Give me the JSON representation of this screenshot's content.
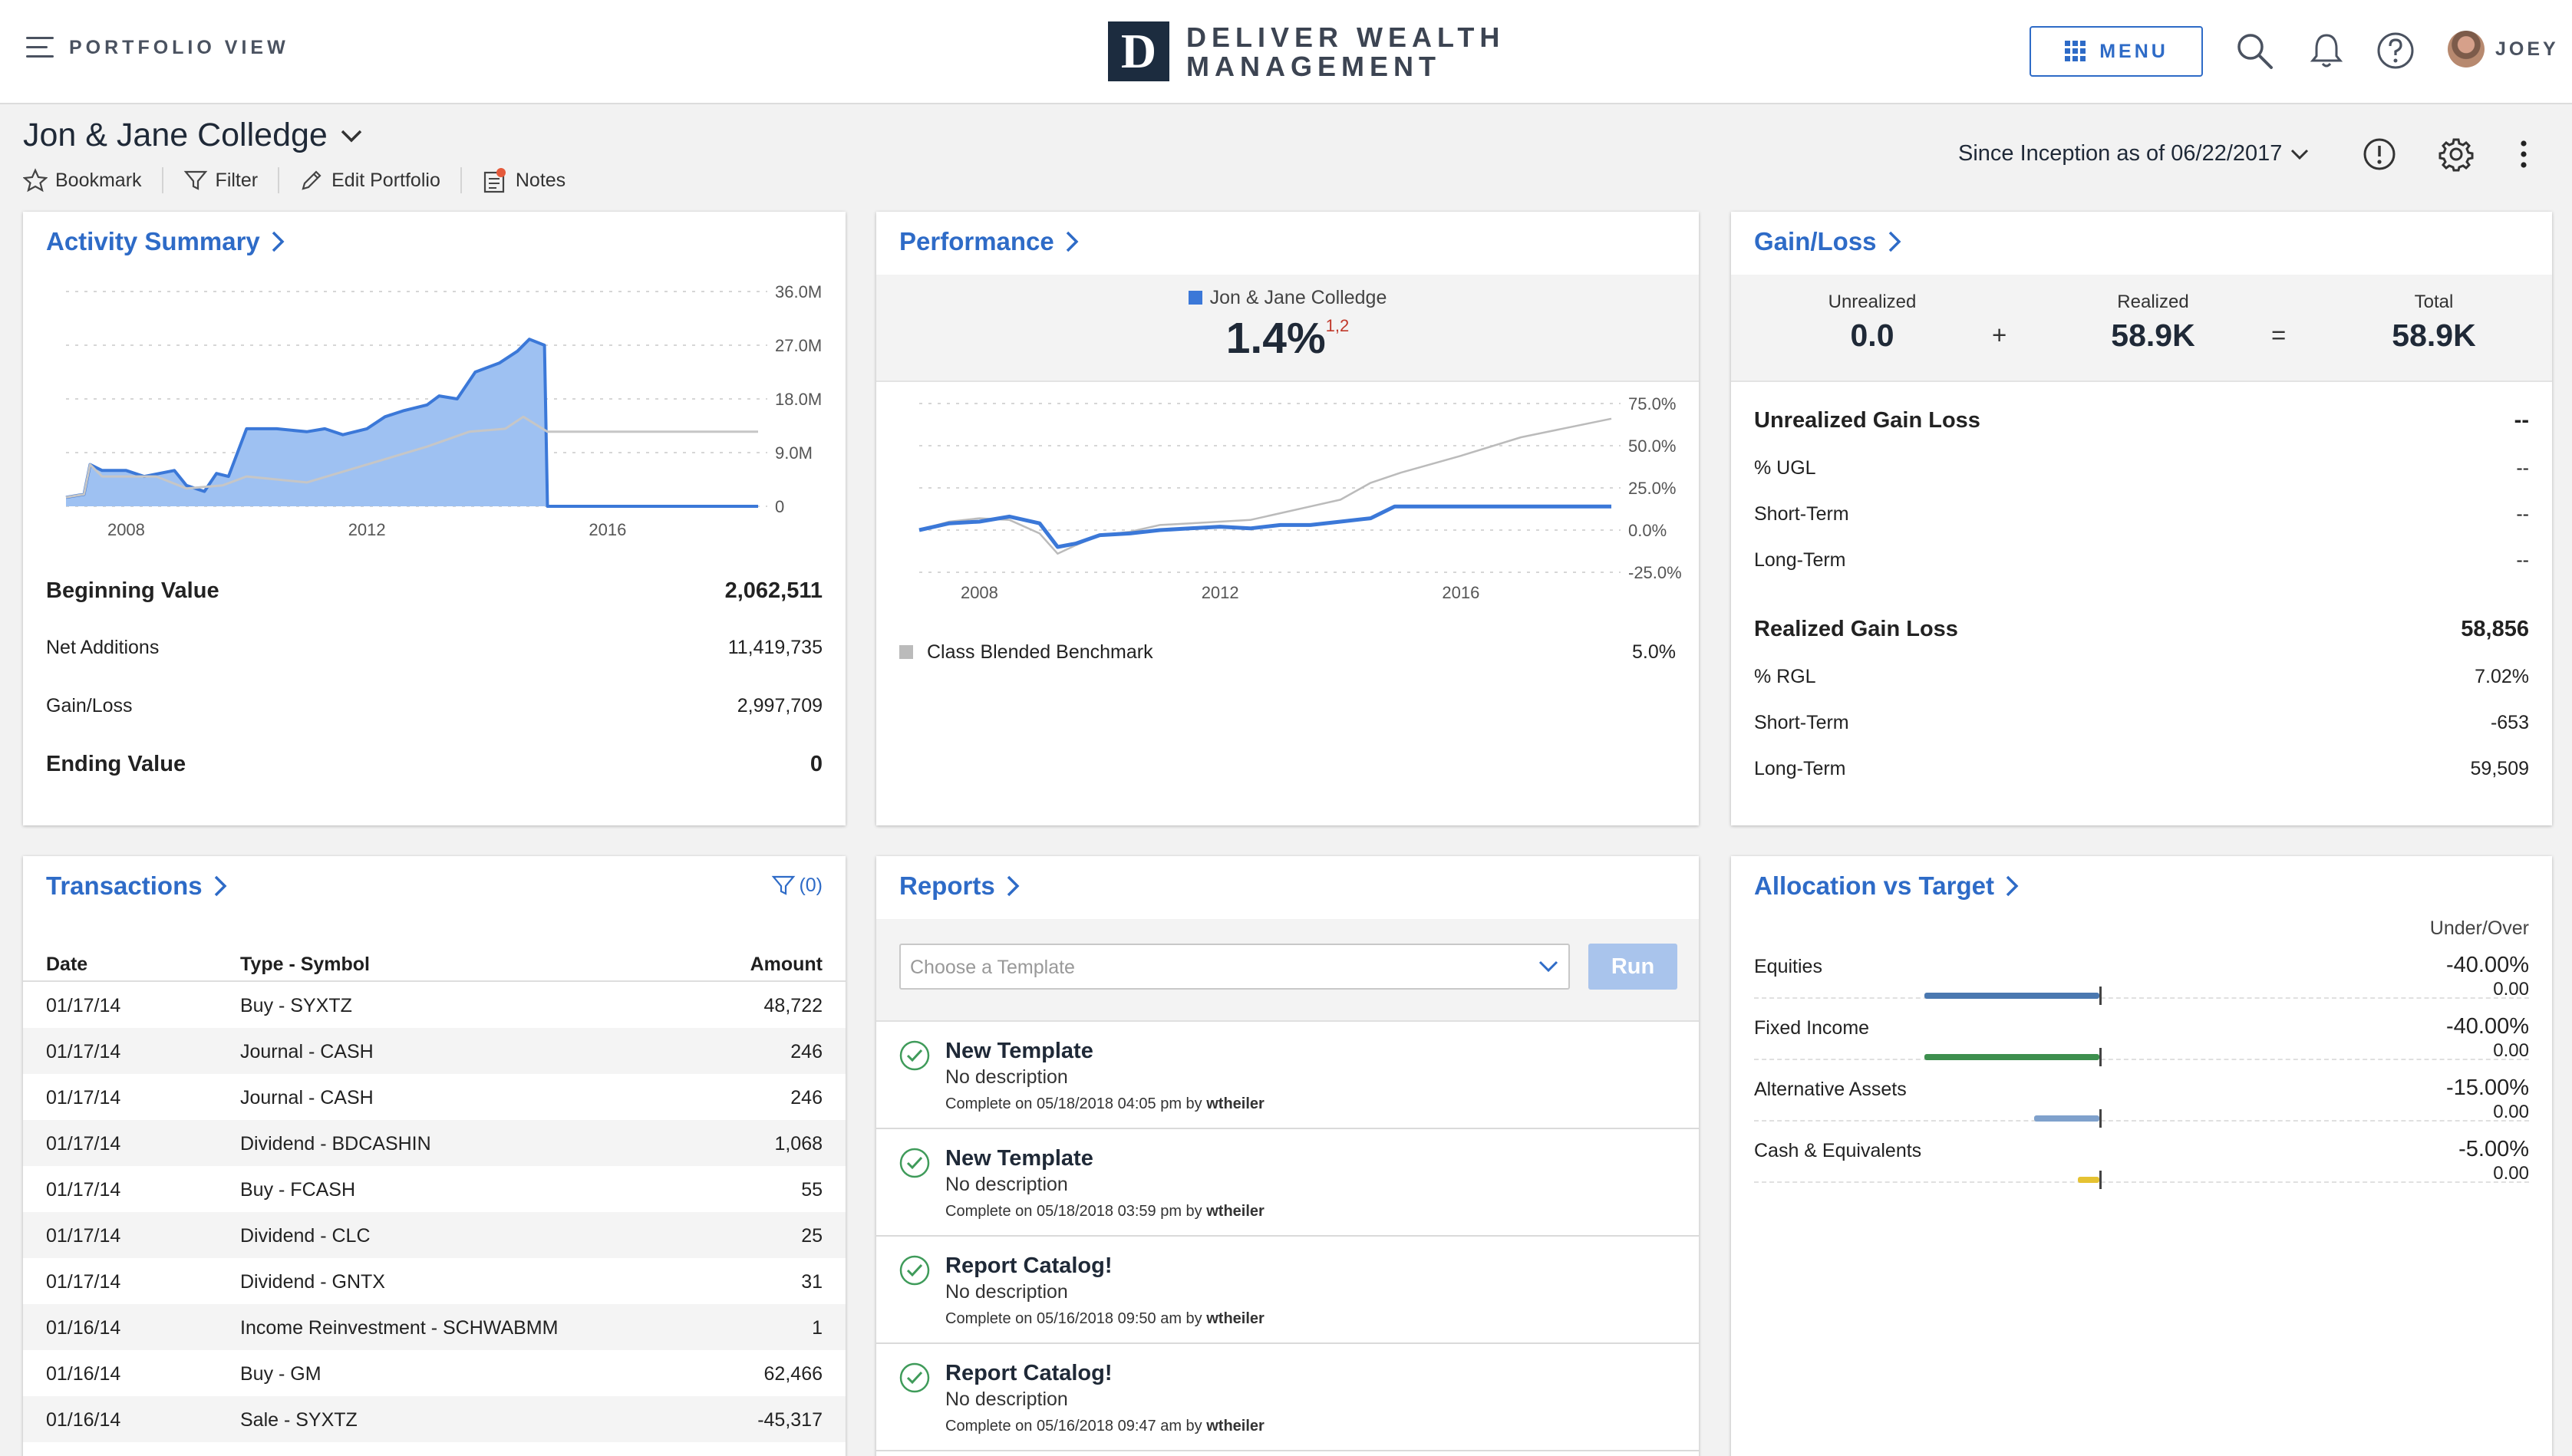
{
  "header": {
    "view_label": "PORTFOLIO VIEW",
    "logo_letter": "D",
    "logo_line1": "DELIVER WEALTH",
    "logo_line2": "MANAGEMENT",
    "menu_label": "MENU",
    "user_name": "JOEY"
  },
  "portfolio": {
    "title": "Jon & Jane Colledge",
    "actions": [
      "Bookmark",
      "Filter",
      "Edit Portfolio",
      "Notes"
    ],
    "period": "Since Inception as of 06/22/2017"
  },
  "activity": {
    "title": "Activity Summary",
    "chart_data": {
      "type": "area",
      "x_tick_labels": [
        "2008",
        "2012",
        "2016"
      ],
      "y_tick_labels": [
        "36.0M",
        "27.0M",
        "18.0M",
        "9.0M",
        "0"
      ],
      "ylim": [
        0,
        36000000
      ],
      "xlim": [
        2007.0,
        2018.5
      ],
      "series": [
        {
          "role": "value",
          "points": [
            [
              2007.0,
              1.5
            ],
            [
              2007.3,
              2.0
            ],
            [
              2007.4,
              7.0
            ],
            [
              2007.6,
              6.0
            ],
            [
              2008.0,
              6.0
            ],
            [
              2008.3,
              5.0
            ],
            [
              2008.8,
              6.0
            ],
            [
              2009.0,
              3.5
            ],
            [
              2009.3,
              2.5
            ],
            [
              2009.5,
              5.5
            ],
            [
              2009.7,
              5.0
            ],
            [
              2010.0,
              13.0
            ],
            [
              2010.5,
              13.0
            ],
            [
              2011.0,
              12.5
            ],
            [
              2011.3,
              13.0
            ],
            [
              2011.6,
              12.0
            ],
            [
              2012.0,
              13.0
            ],
            [
              2012.3,
              15.0
            ],
            [
              2012.6,
              16.0
            ],
            [
              2013.0,
              17.0
            ],
            [
              2013.2,
              18.5
            ],
            [
              2013.5,
              18.0
            ],
            [
              2013.8,
              22.5
            ],
            [
              2014.2,
              24.0
            ],
            [
              2014.5,
              26.0
            ],
            [
              2014.7,
              28.0
            ],
            [
              2014.95,
              27.0
            ],
            [
              2015.0,
              0.0
            ],
            [
              2018.5,
              0.0
            ]
          ]
        },
        {
          "role": "secondary",
          "points": [
            [
              2007.0,
              1.5
            ],
            [
              2007.3,
              2.0
            ],
            [
              2007.4,
              7.0
            ],
            [
              2007.6,
              5.0
            ],
            [
              2008.5,
              5.0
            ],
            [
              2009.0,
              3.0
            ],
            [
              2009.6,
              3.5
            ],
            [
              2010.0,
              5.0
            ],
            [
              2011.0,
              4.0
            ],
            [
              2012.0,
              7.0
            ],
            [
              2013.0,
              10.0
            ],
            [
              2013.7,
              12.5
            ],
            [
              2014.3,
              13.0
            ],
            [
              2014.6,
              15.0
            ],
            [
              2015.0,
              12.5
            ],
            [
              2018.5,
              12.5
            ]
          ]
        }
      ]
    },
    "rows": [
      {
        "label": "Beginning Value",
        "value": "2,062,511",
        "bold": true
      },
      {
        "label": "Net Additions",
        "value": "11,419,735",
        "bold": false
      },
      {
        "label": "Gain/Loss",
        "value": "2,997,709",
        "bold": false
      },
      {
        "label": "Ending Value",
        "value": "0",
        "bold": true
      }
    ]
  },
  "performance": {
    "title": "Performance",
    "legend_name": "Jon & Jane Colledge",
    "value": "1.4%",
    "footnote": "1,2",
    "chart_data": {
      "type": "line",
      "x_tick_labels": [
        "2008",
        "2012",
        "2016"
      ],
      "y_tick_labels": [
        "75.0%",
        "50.0%",
        "25.0%",
        "0.0%",
        "-25.0%"
      ],
      "ylim": [
        -25,
        75
      ],
      "xlim": [
        2007.0,
        2018.5
      ],
      "series": [
        {
          "name": "Jon & Jane Colledge",
          "color": "#3b78d8",
          "points": [
            [
              2007.0,
              0
            ],
            [
              2007.5,
              4
            ],
            [
              2008.0,
              5
            ],
            [
              2008.5,
              8
            ],
            [
              2009.0,
              4
            ],
            [
              2009.3,
              -10
            ],
            [
              2009.6,
              -8
            ],
            [
              2010.0,
              -3
            ],
            [
              2010.5,
              -2
            ],
            [
              2011.0,
              0
            ],
            [
              2011.5,
              1
            ],
            [
              2012.0,
              2
            ],
            [
              2012.5,
              1
            ],
            [
              2013.0,
              3
            ],
            [
              2013.5,
              3
            ],
            [
              2014.0,
              5
            ],
            [
              2014.5,
              7
            ],
            [
              2014.9,
              14
            ],
            [
              2015.0,
              14
            ],
            [
              2018.5,
              14
            ]
          ]
        },
        {
          "name": "Class Blended Benchmark",
          "color": "#bbbbbb",
          "points": [
            [
              2007.0,
              0
            ],
            [
              2007.5,
              5
            ],
            [
              2008.0,
              7
            ],
            [
              2008.5,
              6
            ],
            [
              2009.0,
              -2
            ],
            [
              2009.3,
              -14
            ],
            [
              2009.6,
              -9
            ],
            [
              2010.0,
              -3
            ],
            [
              2010.5,
              -1
            ],
            [
              2011.0,
              3
            ],
            [
              2011.5,
              4
            ],
            [
              2012.0,
              5
            ],
            [
              2012.5,
              6
            ],
            [
              2013.0,
              10
            ],
            [
              2013.5,
              14
            ],
            [
              2014.0,
              18
            ],
            [
              2014.5,
              28
            ],
            [
              2015.0,
              34
            ],
            [
              2016.0,
              44
            ],
            [
              2017.0,
              55
            ],
            [
              2018.5,
              66
            ]
          ]
        }
      ]
    },
    "benchmark_label": "Class Blended Benchmark",
    "benchmark_value": "5.0%"
  },
  "gainloss": {
    "title": "Gain/Loss",
    "unrealized_label": "Unrealized",
    "unrealized_value": "0.0",
    "plus": "+",
    "realized_label": "Realized",
    "realized_value": "58.9K",
    "equals": "=",
    "total_label": "Total",
    "total_value": "58.9K",
    "rows": [
      {
        "label": "Unrealized Gain Loss",
        "value": "--",
        "bold": true
      },
      {
        "label": "% UGL",
        "value": "--",
        "bold": false
      },
      {
        "label": "Short-Term",
        "value": "--",
        "bold": false
      },
      {
        "label": "Long-Term",
        "value": "--",
        "bold": false
      },
      {
        "label": "Realized Gain Loss",
        "value": "58,856",
        "bold": true
      },
      {
        "label": "% RGL",
        "value": "7.02%",
        "bold": false
      },
      {
        "label": "Short-Term",
        "value": "-653",
        "bold": false
      },
      {
        "label": "Long-Term",
        "value": "59,509",
        "bold": false
      }
    ]
  },
  "transactions": {
    "title": "Transactions",
    "filter_count": "(0)",
    "columns": [
      "Date",
      "Type - Symbol",
      "Amount"
    ],
    "rows": [
      {
        "date": "01/17/14",
        "type": "Buy - SYXTZ",
        "amount": "48,722"
      },
      {
        "date": "01/17/14",
        "type": "Journal - CASH",
        "amount": "246"
      },
      {
        "date": "01/17/14",
        "type": "Journal - CASH",
        "amount": "246"
      },
      {
        "date": "01/17/14",
        "type": "Dividend - BDCASHIN",
        "amount": "1,068"
      },
      {
        "date": "01/17/14",
        "type": "Buy - FCASH",
        "amount": "55"
      },
      {
        "date": "01/17/14",
        "type": "Dividend - CLC",
        "amount": "25"
      },
      {
        "date": "01/17/14",
        "type": "Dividend - GNTX",
        "amount": "31"
      },
      {
        "date": "01/16/14",
        "type": "Income Reinvestment - SCHWABMM",
        "amount": "1"
      },
      {
        "date": "01/16/14",
        "type": "Buy - GM",
        "amount": "62,466"
      },
      {
        "date": "01/16/14",
        "type": "Sale - SYXTZ",
        "amount": "-45,317"
      }
    ]
  },
  "reports": {
    "title": "Reports",
    "template_placeholder": "Choose a Template",
    "run_label": "Run",
    "items": [
      {
        "title": "New Template",
        "desc": "No description",
        "meta": "Complete on 05/18/2018 04:05 pm by",
        "user": "wtheiler"
      },
      {
        "title": "New Template",
        "desc": "No description",
        "meta": "Complete on 05/18/2018 03:59 pm by",
        "user": "wtheiler"
      },
      {
        "title": "Report Catalog!",
        "desc": "No description",
        "meta": "Complete on 05/16/2018 09:50 am by",
        "user": "wtheiler"
      },
      {
        "title": "Report Catalog!",
        "desc": "No description",
        "meta": "Complete on 05/16/2018 09:47 am by",
        "user": "wtheiler"
      }
    ]
  },
  "allocation": {
    "title": "Allocation vs Target",
    "col_label": "Under/Over",
    "rows": [
      {
        "label": "Equities",
        "pct": "-40.00%",
        "sub": "0.00",
        "bar_value": -40,
        "color": "#4a78b0"
      },
      {
        "label": "Fixed Income",
        "pct": "-40.00%",
        "sub": "0.00",
        "bar_value": -40,
        "color": "#3d8f4e"
      },
      {
        "label": "Alternative Assets",
        "pct": "-15.00%",
        "sub": "0.00",
        "bar_value": -15,
        "color": "#7fa1cc"
      },
      {
        "label": "Cash & Equivalents",
        "pct": "-5.00%",
        "sub": "0.00",
        "bar_value": -5,
        "color": "#e5c232"
      }
    ]
  }
}
